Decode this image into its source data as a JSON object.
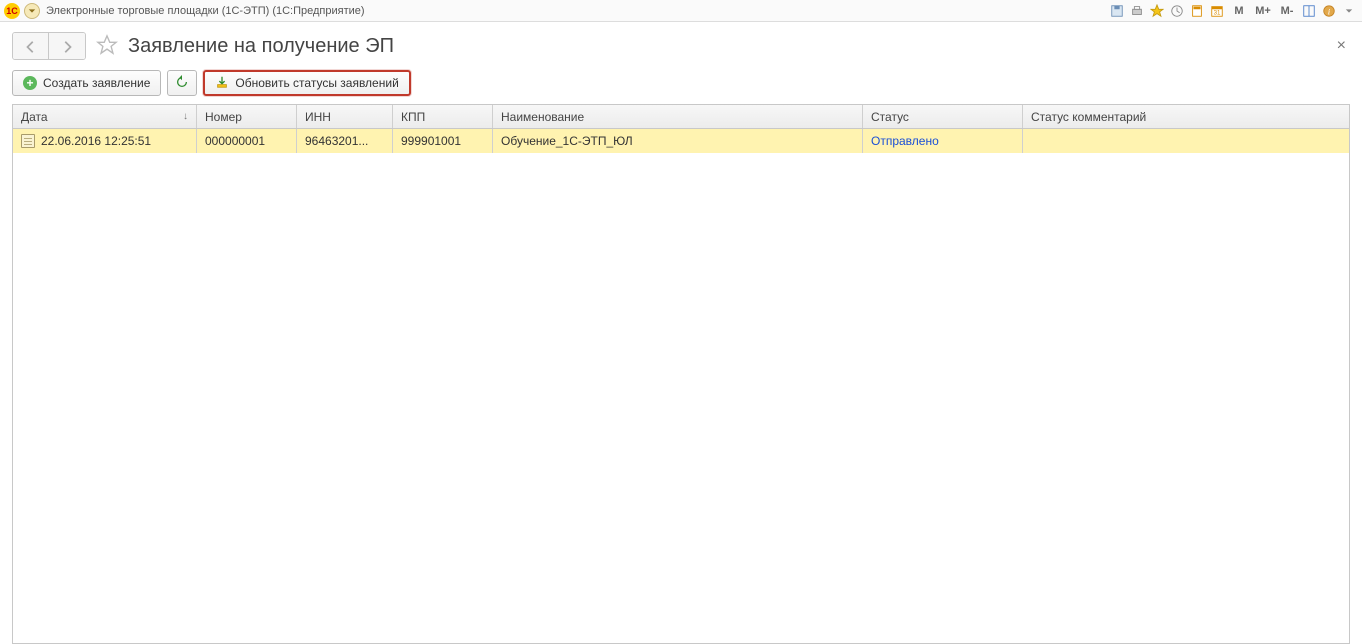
{
  "sysbar": {
    "app_title": "Электронные торговые площадки (1С-ЭТП)  (1С:Предприятие)",
    "m_label": "M",
    "m_plus_label": "M+",
    "m_minus_label": "M-"
  },
  "page": {
    "title": "Заявление на получение ЭП"
  },
  "toolbar": {
    "create_label": "Создать заявление",
    "update_status_label": "Обновить статусы заявлений"
  },
  "table": {
    "headers": {
      "date": "Дата",
      "number": "Номер",
      "inn": "ИНН",
      "kpp": "КПП",
      "name": "Наименование",
      "status": "Статус",
      "status_comment": "Статус комментарий"
    },
    "rows": [
      {
        "date": "22.06.2016 12:25:51",
        "number": "000000001",
        "inn": "96463201...",
        "kpp": "999901001",
        "name": "Обучение_1С-ЭТП_ЮЛ",
        "status": "Отправлено",
        "status_comment": ""
      }
    ]
  }
}
